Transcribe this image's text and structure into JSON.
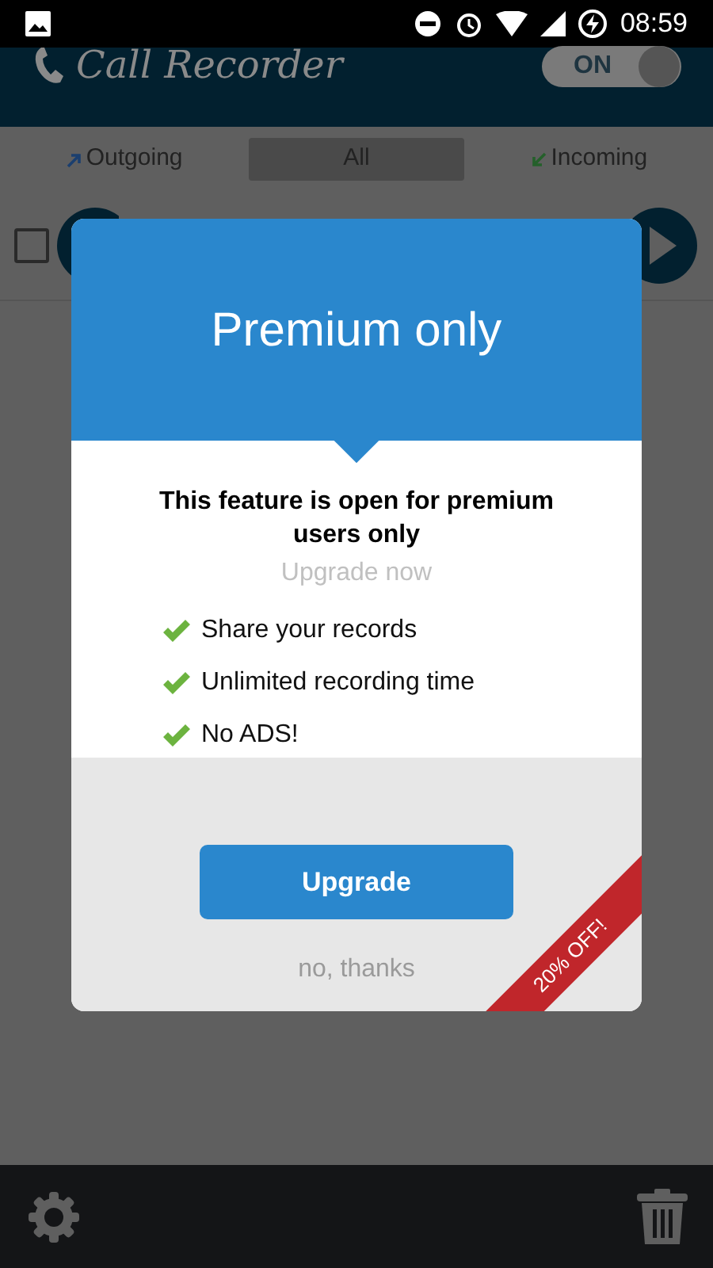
{
  "status_bar": {
    "time": "08:59"
  },
  "app_bar": {
    "title": "Call Recorder",
    "toggle": {
      "label": "ON",
      "on": true
    }
  },
  "tabs": [
    {
      "label": "Outgoing",
      "selected": false,
      "kind": "outgoing"
    },
    {
      "label": "All",
      "selected": true,
      "kind": "all"
    },
    {
      "label": "Incoming",
      "selected": false,
      "kind": "incoming"
    }
  ],
  "record_row": {
    "checked": false
  },
  "dialog": {
    "title": "Premium only",
    "heading": "This feature is open for premium users only",
    "subheading": "Upgrade now",
    "features": [
      "Share your records",
      "Unlimited recording time",
      "No ADS!"
    ],
    "primary_button": "Upgrade",
    "secondary_link": "no, thanks",
    "ribbon": "20% OFF!"
  }
}
